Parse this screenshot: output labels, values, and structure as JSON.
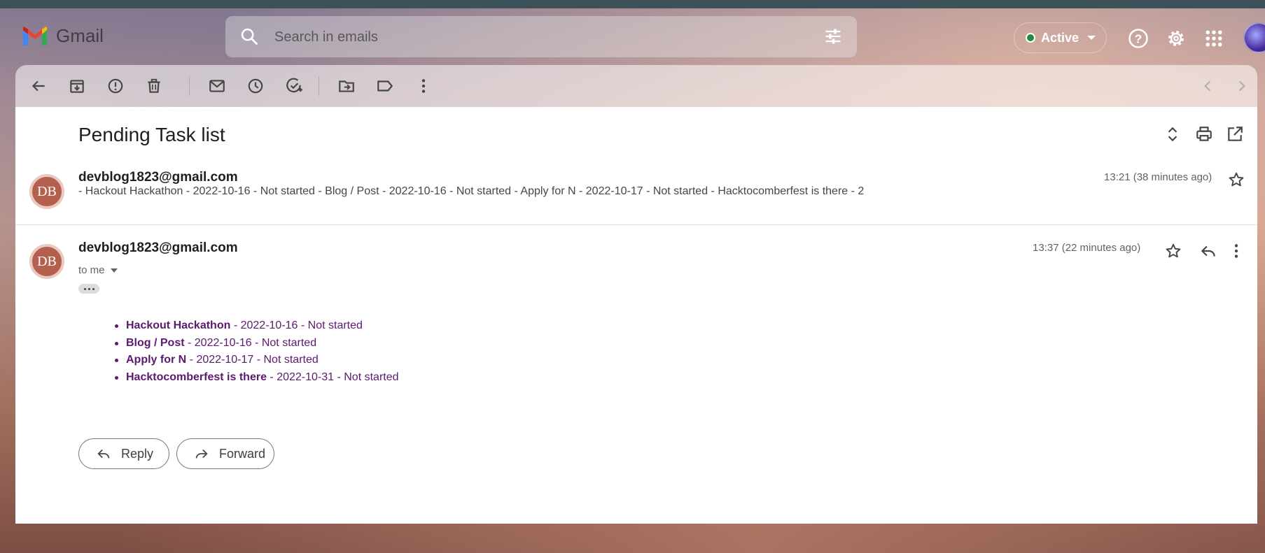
{
  "app": {
    "name": "Gmail"
  },
  "search": {
    "placeholder": "Search in emails"
  },
  "status": {
    "label": "Active"
  },
  "thread": {
    "subject": "Pending Task list",
    "messages": [
      {
        "avatar_initials": "DB",
        "sender": "devblog1823@gmail.com",
        "time": "13:21 (38 minutes ago)",
        "snippet": "- Hackout Hackathon - 2022-10-16 - Not started - Blog / Post - 2022-10-16 - Not started - Apply for N - 2022-10-17 - Not started - Hacktocomberfest is there - 2"
      },
      {
        "avatar_initials": "DB",
        "sender": "devblog1823@gmail.com",
        "time": "13:37 (22 minutes ago)",
        "recipient": "to me",
        "tasks": [
          {
            "name": "Hackout Hackathon",
            "detail": " - 2022-10-16 - Not started"
          },
          {
            "name": "Blog / Post",
            "detail": " - 2022-10-16 - Not started"
          },
          {
            "name": "Apply for N",
            "detail": " - 2022-10-17 - Not started"
          },
          {
            "name": "Hacktocomberfest is there",
            "detail": " - 2022-10-31 - Not started"
          }
        ]
      }
    ]
  },
  "actions": {
    "reply_label": "Reply",
    "forward_label": "Forward"
  },
  "colors": {
    "link_purple": "#5b1a6e",
    "avatar_bg": "#b5604e",
    "active_dot": "#1e8e3e"
  },
  "icons": [
    "search-icon",
    "tune-icon",
    "help-icon",
    "gear-icon",
    "apps-icon",
    "back-icon",
    "archive-icon",
    "report-spam-icon",
    "delete-icon",
    "mark-unread-icon",
    "snooze-icon",
    "add-task-icon",
    "move-to-icon",
    "label-icon",
    "more-icon",
    "older-icon",
    "newer-icon",
    "expand-all-icon",
    "print-icon",
    "open-new-window-icon",
    "star-icon",
    "reply-icon"
  ]
}
